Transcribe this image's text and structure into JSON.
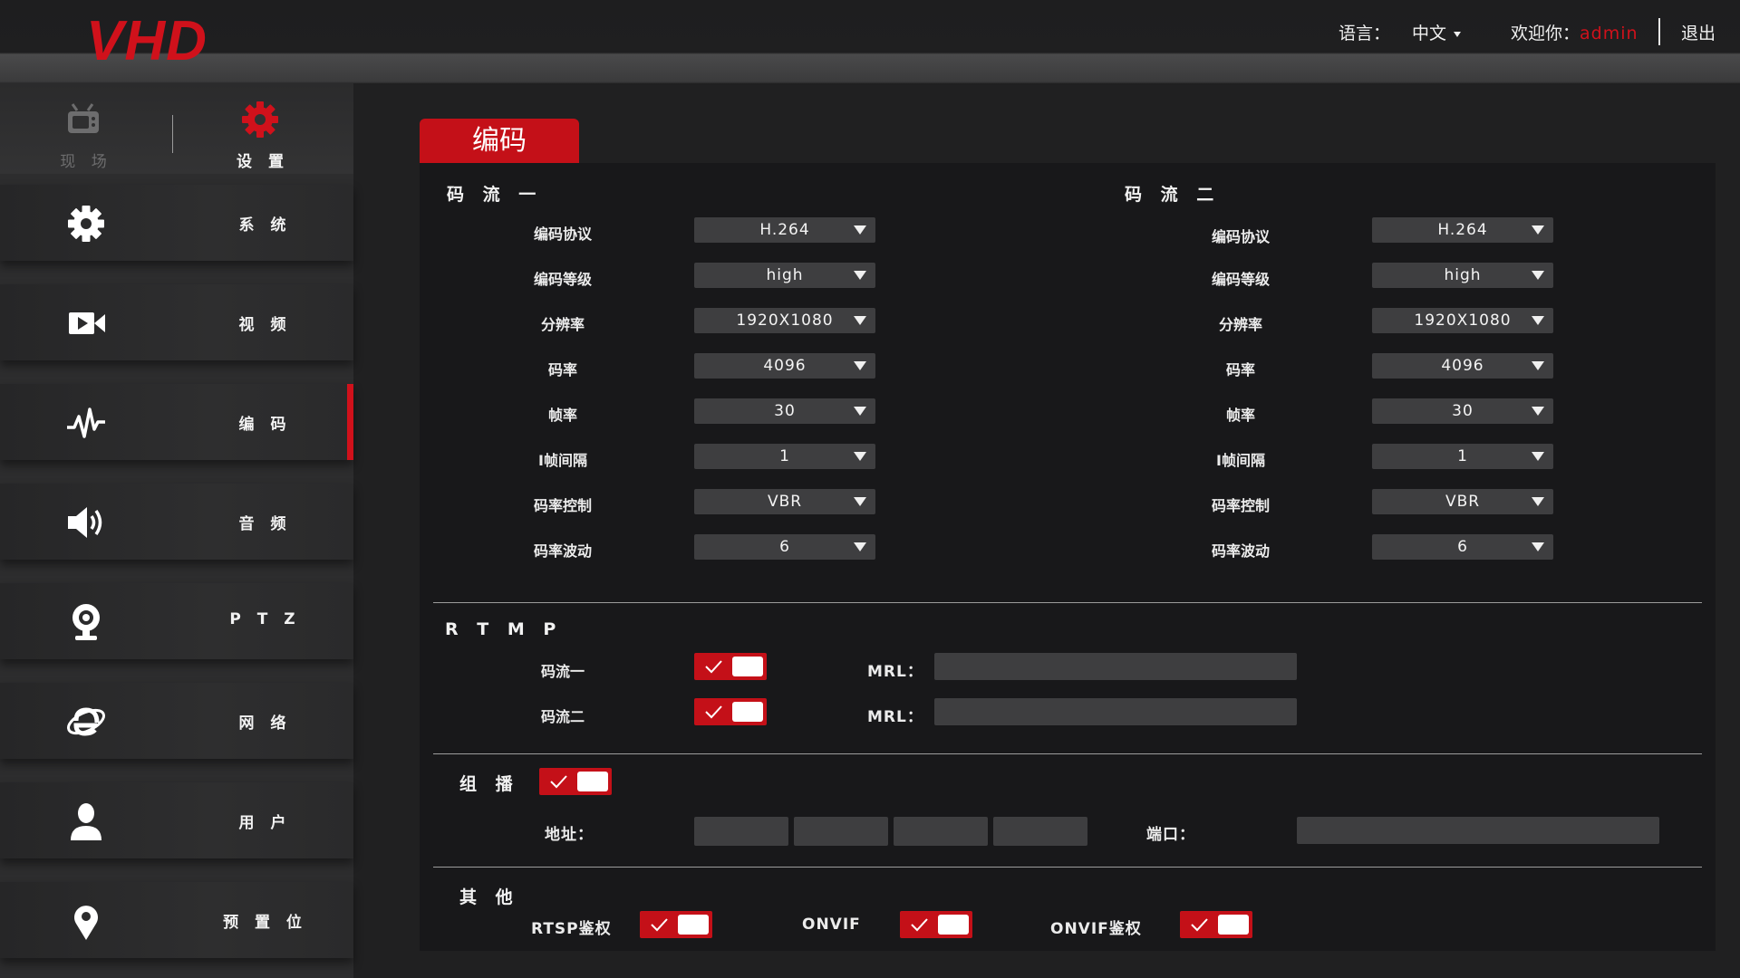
{
  "header": {
    "logo": "VHD",
    "lang_label": "语言：",
    "lang_value": "中文",
    "welcome_label": "欢迎你：",
    "username": "admin",
    "logout": "退出"
  },
  "sidebar": {
    "top_tabs": [
      {
        "label": "现 场",
        "icon": "tv-icon",
        "active": false
      },
      {
        "label": "设 置",
        "icon": "gear-icon",
        "active": true
      }
    ],
    "items": [
      {
        "label": "系 统",
        "icon": "gear-icon"
      },
      {
        "label": "视 频",
        "icon": "video-camera-icon"
      },
      {
        "label": "编 码",
        "icon": "waveform-icon",
        "active": true
      },
      {
        "label": "音 频",
        "icon": "speaker-icon"
      },
      {
        "label": "P T Z",
        "icon": "webcam-icon"
      },
      {
        "label": "网 络",
        "icon": "internet-icon"
      },
      {
        "label": "用 户",
        "icon": "user-icon"
      },
      {
        "label": "预 置 位",
        "icon": "location-pin-icon"
      }
    ]
  },
  "main": {
    "title": "编码",
    "stream1": {
      "title": "码 流 一",
      "rows": [
        {
          "label": "编码协议",
          "value": "H.264"
        },
        {
          "label": "编码等级",
          "value": "high"
        },
        {
          "label": "分辨率",
          "value": "1920X1080"
        },
        {
          "label": "码率",
          "value": "4096"
        },
        {
          "label": "帧率",
          "value": "30"
        },
        {
          "label": "I帧间隔",
          "value": "1"
        },
        {
          "label": "码率控制",
          "value": "VBR"
        },
        {
          "label": "码率波动",
          "value": "6"
        }
      ]
    },
    "stream2": {
      "title": "码 流 二",
      "rows": [
        {
          "label": "编码协议",
          "value": "H.264"
        },
        {
          "label": "编码等级",
          "value": "high"
        },
        {
          "label": "分辨率",
          "value": "1920X1080"
        },
        {
          "label": "码率",
          "value": "4096"
        },
        {
          "label": "帧率",
          "value": "30"
        },
        {
          "label": "I帧间隔",
          "value": "1"
        },
        {
          "label": "码率控制",
          "value": "VBR"
        },
        {
          "label": "码率波动",
          "value": "6"
        }
      ]
    },
    "rtmp": {
      "title": "R T M P",
      "rows": [
        {
          "label": "码流一",
          "enabled": true,
          "mrl_label": "MRL：",
          "mrl_value": ""
        },
        {
          "label": "码流二",
          "enabled": true,
          "mrl_label": "MRL：",
          "mrl_value": ""
        }
      ]
    },
    "multicast": {
      "title": "组 播",
      "enabled": true,
      "address_label": "地址：",
      "address_octets": [
        "",
        "",
        "",
        ""
      ],
      "port_label": "端口：",
      "port_value": ""
    },
    "other": {
      "title": "其 他",
      "items": [
        {
          "label": "RTSP鉴权",
          "enabled": true
        },
        {
          "label": "ONVIF",
          "enabled": true
        },
        {
          "label": "ONVIF鉴权",
          "enabled": true
        }
      ]
    }
  },
  "colors": {
    "accent": "#c41018",
    "logo_red": "#d0111b",
    "panel_bg": "#18181a",
    "control_bg": "#3e3e40"
  }
}
